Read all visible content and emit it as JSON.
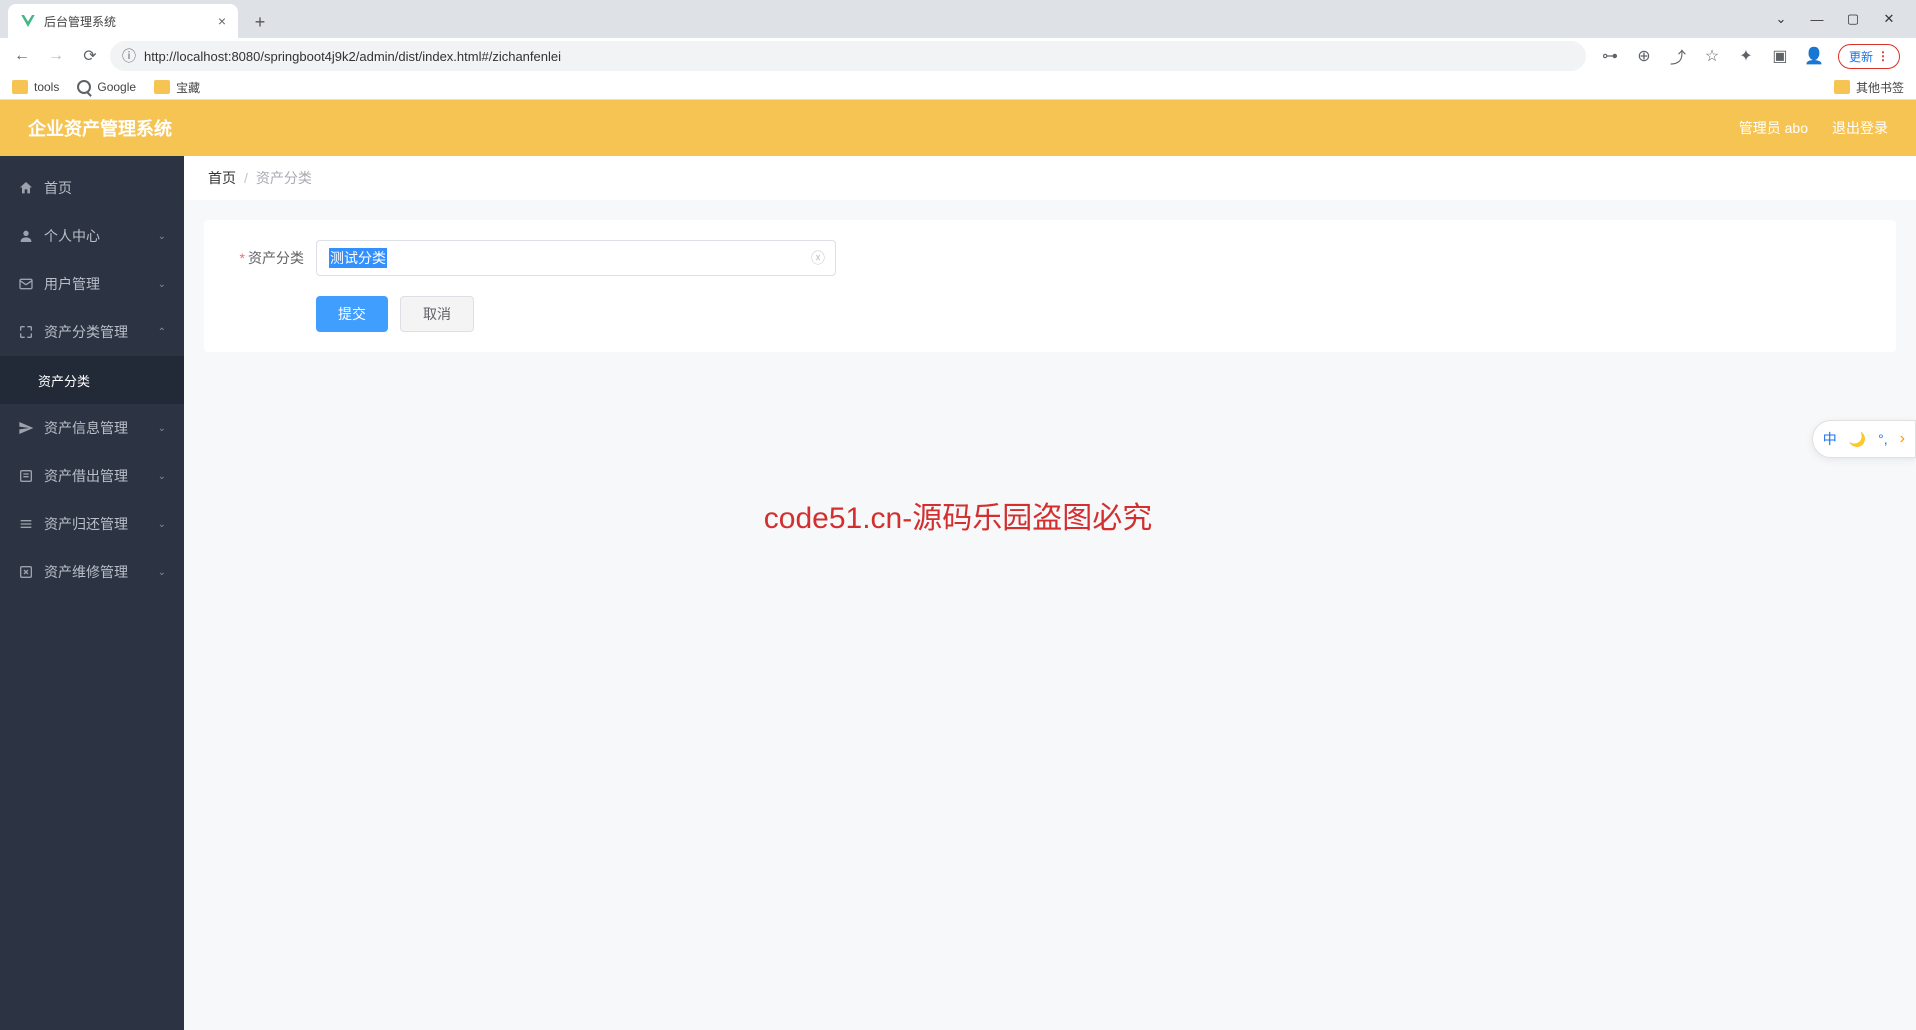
{
  "browser": {
    "tab_title": "后台管理系统",
    "url": "http://localhost:8080/springboot4j9k2/admin/dist/index.html#/zichanfenlei",
    "update_label": "更新",
    "bookmarks": {
      "tools": "tools",
      "google": "Google",
      "treasure": "宝藏",
      "other": "其他书签"
    }
  },
  "header": {
    "app_title": "企业资产管理系统",
    "user_label": "管理员 abo",
    "logout_label": "退出登录"
  },
  "sidebar": {
    "items": [
      {
        "label": "首页",
        "icon": "home",
        "expandable": false
      },
      {
        "label": "个人中心",
        "icon": "user",
        "expandable": true
      },
      {
        "label": "用户管理",
        "icon": "mail",
        "expandable": true
      },
      {
        "label": "资产分类管理",
        "icon": "expand",
        "expandable": true
      },
      {
        "label": "资产分类",
        "icon": "",
        "sub": true
      },
      {
        "label": "资产信息管理",
        "icon": "send",
        "expandable": true
      },
      {
        "label": "资产借出管理",
        "icon": "list",
        "expandable": true
      },
      {
        "label": "资产归还管理",
        "icon": "bars",
        "expandable": true
      },
      {
        "label": "资产维修管理",
        "icon": "close-sq",
        "expandable": true
      }
    ]
  },
  "breadcrumb": {
    "home": "首页",
    "current": "资产分类"
  },
  "form": {
    "field_label": "资产分类",
    "field_value": "测试分类",
    "submit_label": "提交",
    "cancel_label": "取消"
  },
  "float_toolbar": {
    "ime": "中",
    "moon": "🌙",
    "punct": "°,",
    "arrow": "›"
  },
  "watermark": "code51.cn-源码乐园盗图必究"
}
